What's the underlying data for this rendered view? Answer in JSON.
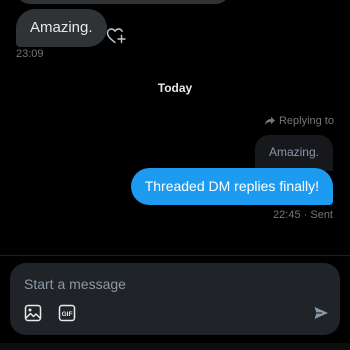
{
  "thread": {
    "received_message": {
      "text": "Amazing.",
      "time": "23:09"
    },
    "day_divider": "Today",
    "sent_message": {
      "replying_to_label": "Replying to",
      "quoted_text": "Amazing.",
      "text": "Threaded DM replies finally!",
      "status": "22:45 · Sent"
    }
  },
  "composer": {
    "placeholder": "Start a message",
    "gif_label": "GIF"
  },
  "icons": {
    "react": "heart-plus-icon",
    "reply": "reply-arrow-icon",
    "image": "image-icon",
    "gif": "gif-icon",
    "send": "send-icon"
  },
  "colors": {
    "background": "#000000",
    "received_bubble": "#2f3336",
    "sent_bubble": "#1d9bf0",
    "composer": "#202327",
    "muted_text": "#71767b"
  }
}
